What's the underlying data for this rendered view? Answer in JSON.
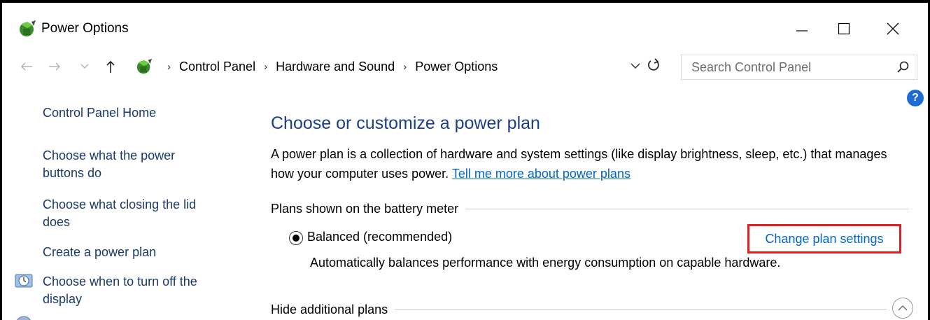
{
  "window": {
    "title": "Power Options",
    "controls": {
      "minimize": "minimize",
      "maximize": "maximize",
      "close": "close"
    }
  },
  "address_bar": {
    "breadcrumbs": [
      "Control Panel",
      "Hardware and Sound",
      "Power Options"
    ],
    "search_placeholder": "Search Control Panel"
  },
  "sidebar": {
    "items": [
      {
        "label": "Control Panel Home"
      },
      {
        "label": "Choose what the power buttons do"
      },
      {
        "label": "Choose what closing the lid does"
      },
      {
        "label": "Create a power plan"
      },
      {
        "label": "Choose when to turn off the display",
        "icon": "clock-icon"
      }
    ]
  },
  "main": {
    "heading": "Choose or customize a power plan",
    "description": "A power plan is a collection of hardware and system settings (like display brightness, sleep, etc.) that manages how your computer uses power.",
    "learn_more_link": "Tell me more about power plans",
    "battery_group_title": "Plans shown on the battery meter",
    "plan": {
      "name": "Balanced (recommended)",
      "selected": true,
      "description": "Automatically balances performance with energy consumption on capable hardware.",
      "change_link": "Change plan settings"
    },
    "additional_group_title": "Hide additional plans"
  },
  "colors": {
    "heading": "#1d3e8a",
    "link": "#0066cc",
    "highlight_box": "#e02020",
    "help_badge": "#1e6bd6"
  }
}
